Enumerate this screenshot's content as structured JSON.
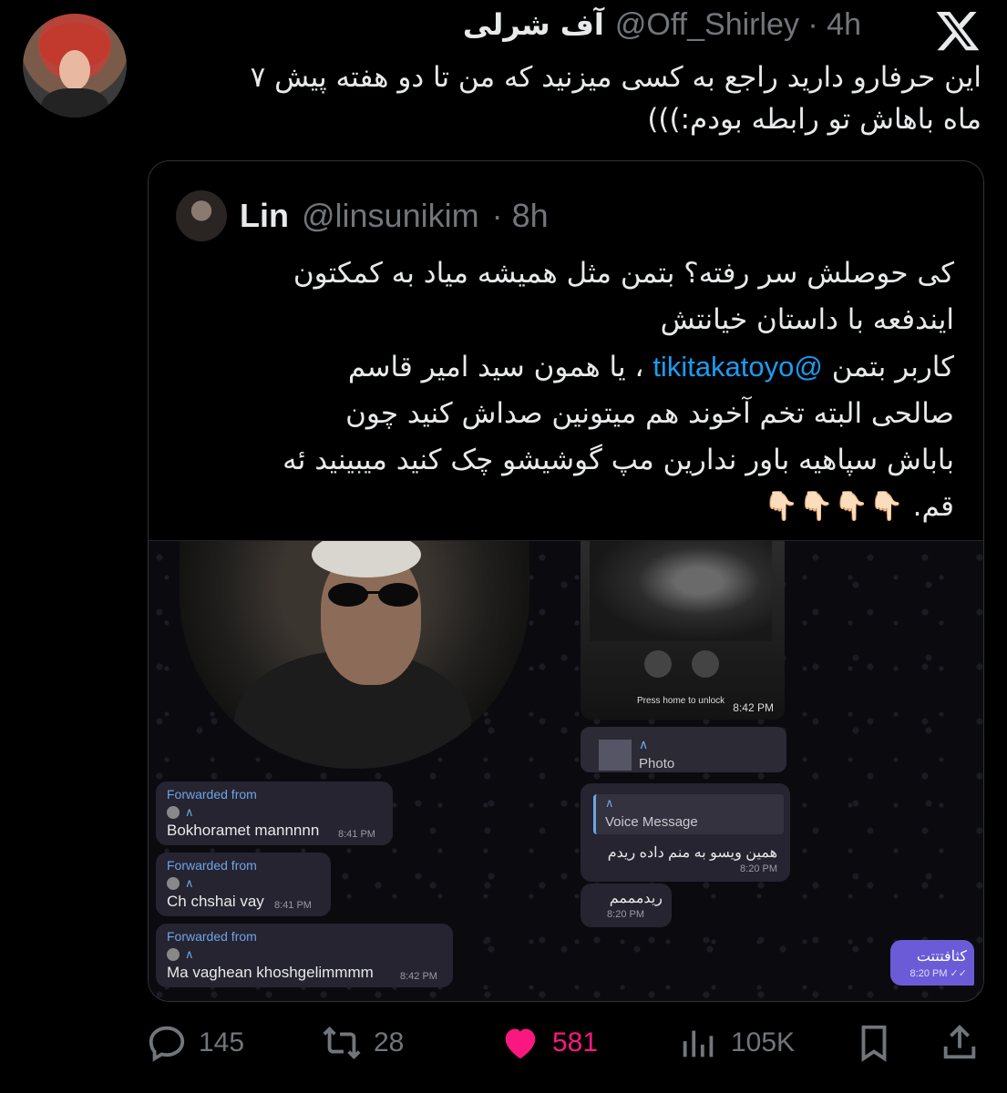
{
  "tweet": {
    "display_name": "آف شرلی",
    "handle": "@Off_Shirley",
    "time": "· 4h",
    "text_line1": "این حرفارو دارید راجع به کسی میزنید که من تا دو هفته پیش ۷",
    "text_line2": "ماه باهاش تو رابطه بودم:)))"
  },
  "quote": {
    "display_name": "Lin",
    "handle": "@linsunikim",
    "time": "· 8h",
    "line1": "کی حوصلش سر رفته؟ بتمن مثل همیشه میاد به کمکتون",
    "line2": "ایندفعه با داستان خیانتش",
    "line3_prefix": "کاربر بتمن",
    "mention": "@tikitakatoyo",
    "line3_suffix": "، یا همون سید امیر قاسم",
    "line4": "صالحی البته تخم آخوند هم میتونین صداش کنید چون",
    "line5": "باباش سپاهیه باور ندارین مپ گوشیشو چک کنید میبینید ئه",
    "line6": "قم. 👇🏻👇🏻👇🏻👇🏻"
  },
  "media": {
    "lock_label": "Press home to unlock",
    "lock_time": "8:42 PM",
    "photo_arrow": "∧",
    "photo_label": "Photo",
    "fwd": [
      {
        "from": "Forwarded from",
        "a": "∧",
        "msg": "Bokhoramet mannnnn",
        "ts": "8:41 PM"
      },
      {
        "from": "Forwarded from",
        "a": "∧",
        "msg": "Ch chshai vay",
        "ts": "8:41 PM"
      },
      {
        "from": "Forwarded from",
        "a": "∧",
        "msg": "Ma vaghean khoshgelimmmm",
        "ts": "8:42 PM"
      }
    ],
    "voice_arrow": "∧",
    "voice_label": "Voice Message",
    "voice_text": "همین ویسو به منم داده ریدم",
    "voice_ts": "8:20 PM",
    "small_text": "ریدمممم",
    "small_ts": "8:20 PM",
    "out_text": "کثافتتتت",
    "out_ts": "8:20 PM"
  },
  "actions": {
    "replies": "145",
    "retweets": "28",
    "likes": "581",
    "views": "105K"
  },
  "colors": {
    "background": "#000000",
    "like": "#f91880",
    "link": "#1d9bf0",
    "muted": "#71767b"
  }
}
